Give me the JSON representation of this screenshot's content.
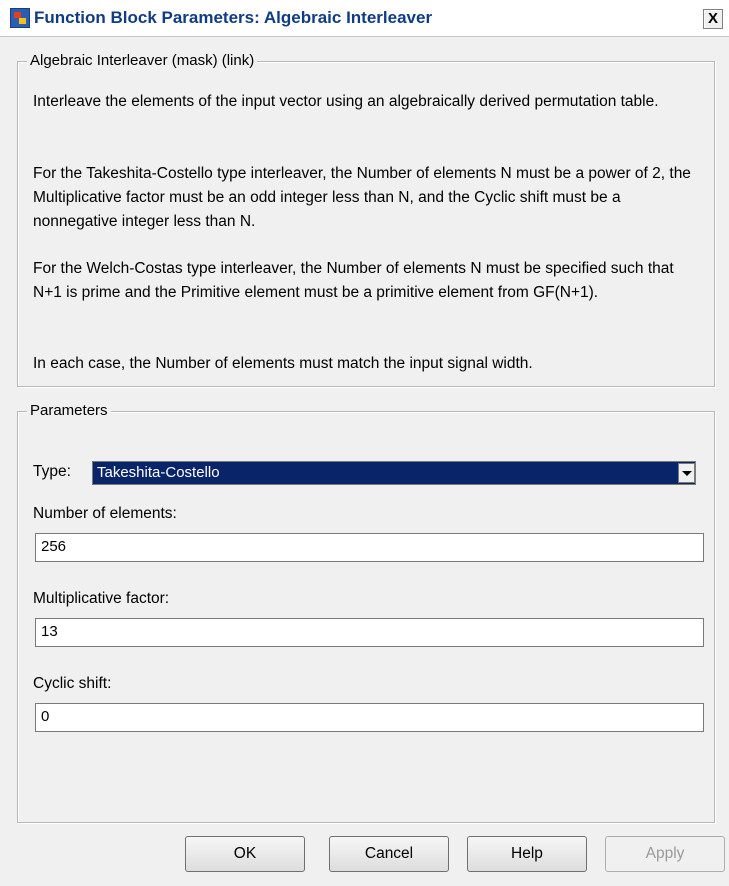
{
  "window": {
    "title": "Function Block Parameters: Algebraic Interleaver",
    "close_label": "X"
  },
  "mask_group": {
    "title": "Algebraic Interleaver (mask) (link)",
    "paragraphs": [
      "Interleave the elements of the input vector using an algebraically derived permutation table.",
      "For the Takeshita-Costello type interleaver, the Number of elements N must be a power of 2, the Multiplicative factor must be an odd integer less than N, and the Cyclic shift must be a nonnegative integer less than N.",
      "For the Welch-Costas type interleaver, the Number of elements N must be specified such that N+1 is prime and the Primitive element must be a primitive element from GF(N+1).",
      "In each case, the Number of elements must match the input signal width."
    ]
  },
  "parameters_group": {
    "title": "Parameters",
    "type": {
      "label": "Type:",
      "value": "Takeshita-Costello"
    },
    "number_of_elements": {
      "label": "Number of elements:",
      "value": "256"
    },
    "multiplicative_factor": {
      "label": "Multiplicative factor:",
      "value": "13"
    },
    "cyclic_shift": {
      "label": "Cyclic shift:",
      "value": "0"
    }
  },
  "buttons": {
    "ok": "OK",
    "cancel": "Cancel",
    "help": "Help",
    "apply": "Apply"
  }
}
